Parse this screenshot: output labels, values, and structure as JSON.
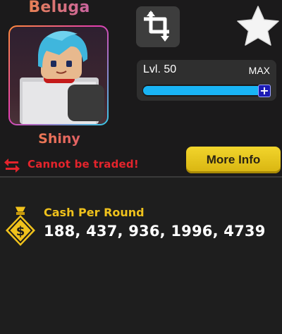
{
  "unit": {
    "name": "Beluga",
    "rarity": "Shiny",
    "trade_status": "Cannot be traded!"
  },
  "level": {
    "label": "Lvl. 50",
    "max_label": "MAX",
    "progress": 1.0
  },
  "buttons": {
    "more_info": "More Info",
    "plus": "+"
  },
  "stats": {
    "cash_label": "Cash Per Round",
    "cash_values": "188, 437, 936, 1996, 4739"
  },
  "icons": {
    "swap": "crop-swap-icon",
    "favorite": "star-icon",
    "trade": "trade-arrows-icon",
    "cash": "money-bag-icon"
  },
  "colors": {
    "background": "#1b1a1b",
    "trade_red": "#e4242c",
    "level_fill": "#19b4f5",
    "more_info_yellow": "#e2c21e",
    "cash_gold": "#f0c21c"
  }
}
